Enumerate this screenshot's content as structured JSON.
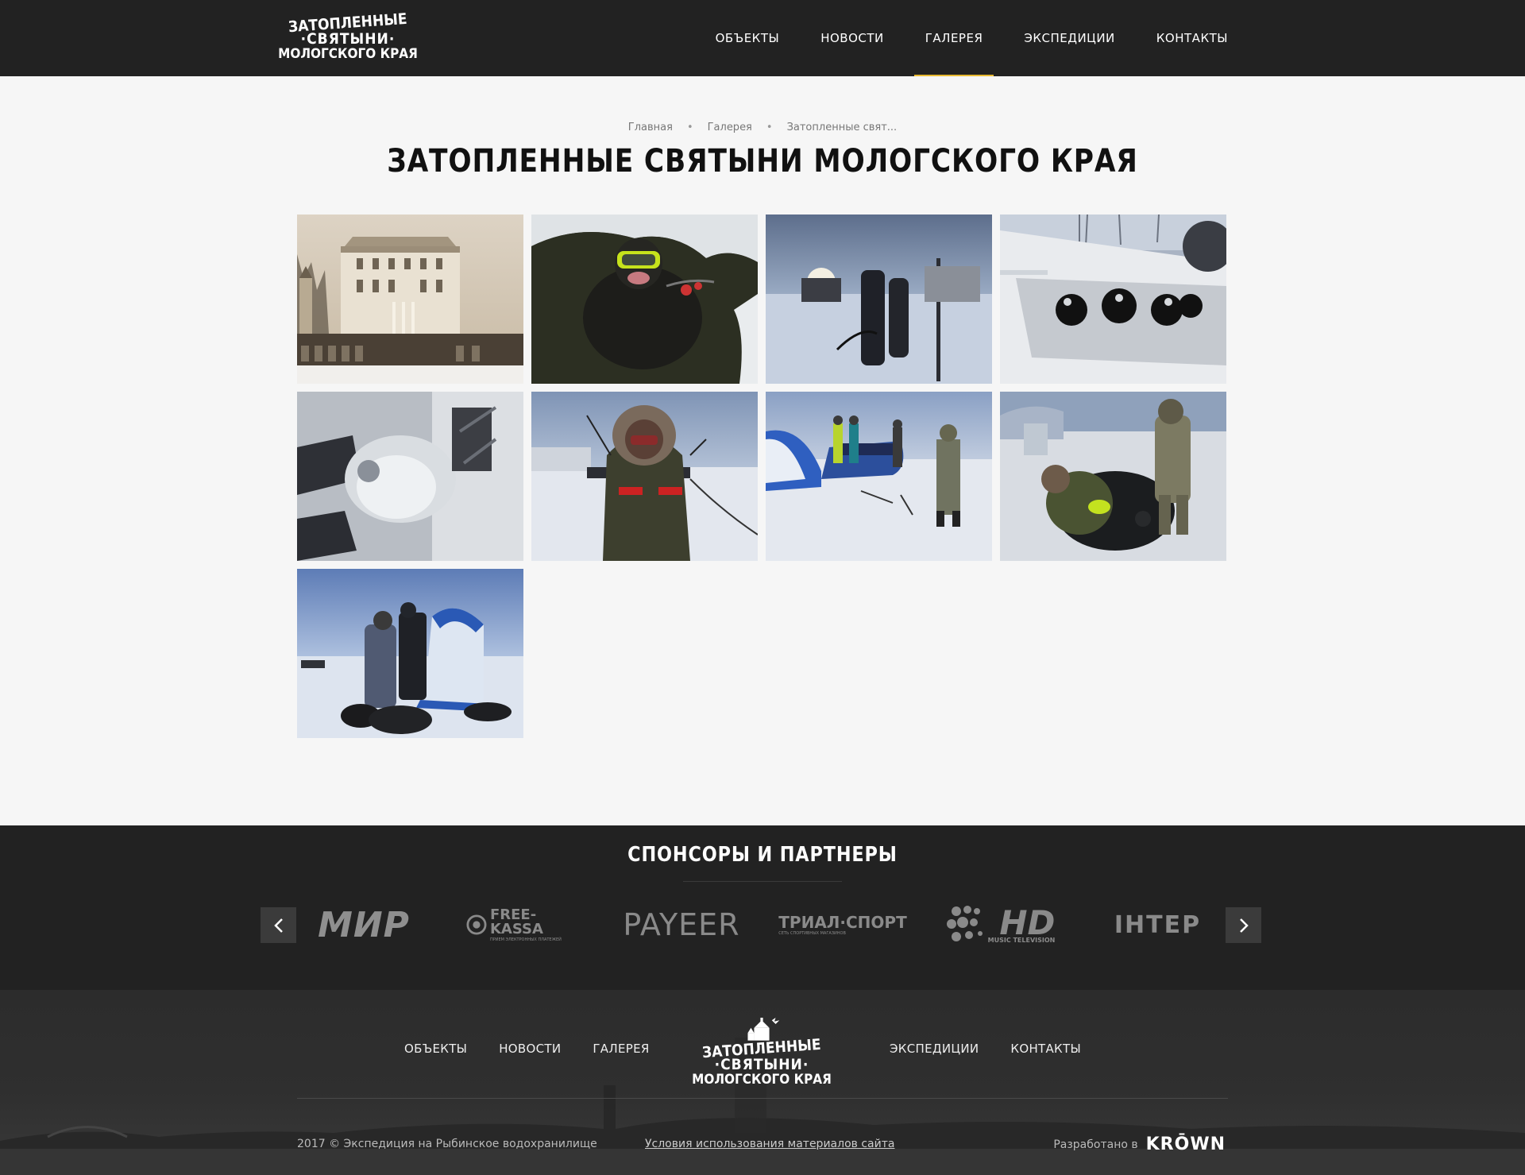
{
  "header": {
    "logo_lines": [
      "ЗАТОПЛЕННЫЕ",
      "·СВЯТЫНИ·",
      "МОЛОГСКОГО КРАЯ"
    ],
    "nav": [
      {
        "label": "ОБЪЕКТЫ"
      },
      {
        "label": "НОВОСТИ"
      },
      {
        "label": "ГАЛЕРЕЯ",
        "active": true
      },
      {
        "label": "ЭКСПЕДИЦИИ"
      },
      {
        "label": "КОНТАКТЫ"
      }
    ]
  },
  "breadcrumb": [
    "Главная",
    "Галерея",
    "Затопленные свят..."
  ],
  "page_title": "ЗАТОПЛЕННЫЕ СВЯТЫНИ МОЛОГСКОГО КРАЯ",
  "gallery": {
    "photos": [
      {
        "name": "manor-house-photo"
      },
      {
        "name": "diver-in-ice-hole-photo"
      },
      {
        "name": "equipment-on-ice-photo"
      },
      {
        "name": "scuba-gear-in-hovercraft-photo"
      },
      {
        "name": "frozen-regulator-photo"
      },
      {
        "name": "person-in-parka-photo"
      },
      {
        "name": "team-on-ice-photo"
      },
      {
        "name": "divers-at-ice-hole-photo"
      },
      {
        "name": "divers-by-tent-photo"
      }
    ]
  },
  "sponsors": {
    "title": "СПОНСОРЫ И ПАРТНЕРЫ",
    "logos": [
      {
        "label": "МИР"
      },
      {
        "label": "FREE-KASSA",
        "sub": "ПРИЕМ ЭЛЕКТРОННЫХ ПЛАТЕЖЕЙ"
      },
      {
        "label": "PAYEER"
      },
      {
        "label": "ТРИАЛ·СПОРТ",
        "sub": "СЕТЬ СПОРТИВНЫХ МАГАЗИНОВ"
      },
      {
        "label": "HD",
        "sub": "MUSIC TELEVISION"
      },
      {
        "label": "ІНТЕР"
      }
    ]
  },
  "footer": {
    "nav_left": [
      "ОБЪЕКТЫ",
      "НОВОСТИ",
      "ГАЛЕРЕЯ"
    ],
    "nav_right": [
      "ЭКСПЕДИЦИИ",
      "КОНТАКТЫ"
    ],
    "logo_lines": [
      "ЗАТОПЛЕННЫЕ",
      "·СВЯТЫНИ·",
      "МОЛОГСКОГО КРАЯ"
    ],
    "copyright": "2017 © Экспедиция на Рыбинское водохранилище",
    "terms": "Условия использования материалов сайта",
    "developed_by": "Разработано в",
    "developer": "KRŌWN"
  },
  "colors": {
    "header_bg": "#222222",
    "active_underline": "#e8b931",
    "page_bg": "#f6f6f6"
  }
}
